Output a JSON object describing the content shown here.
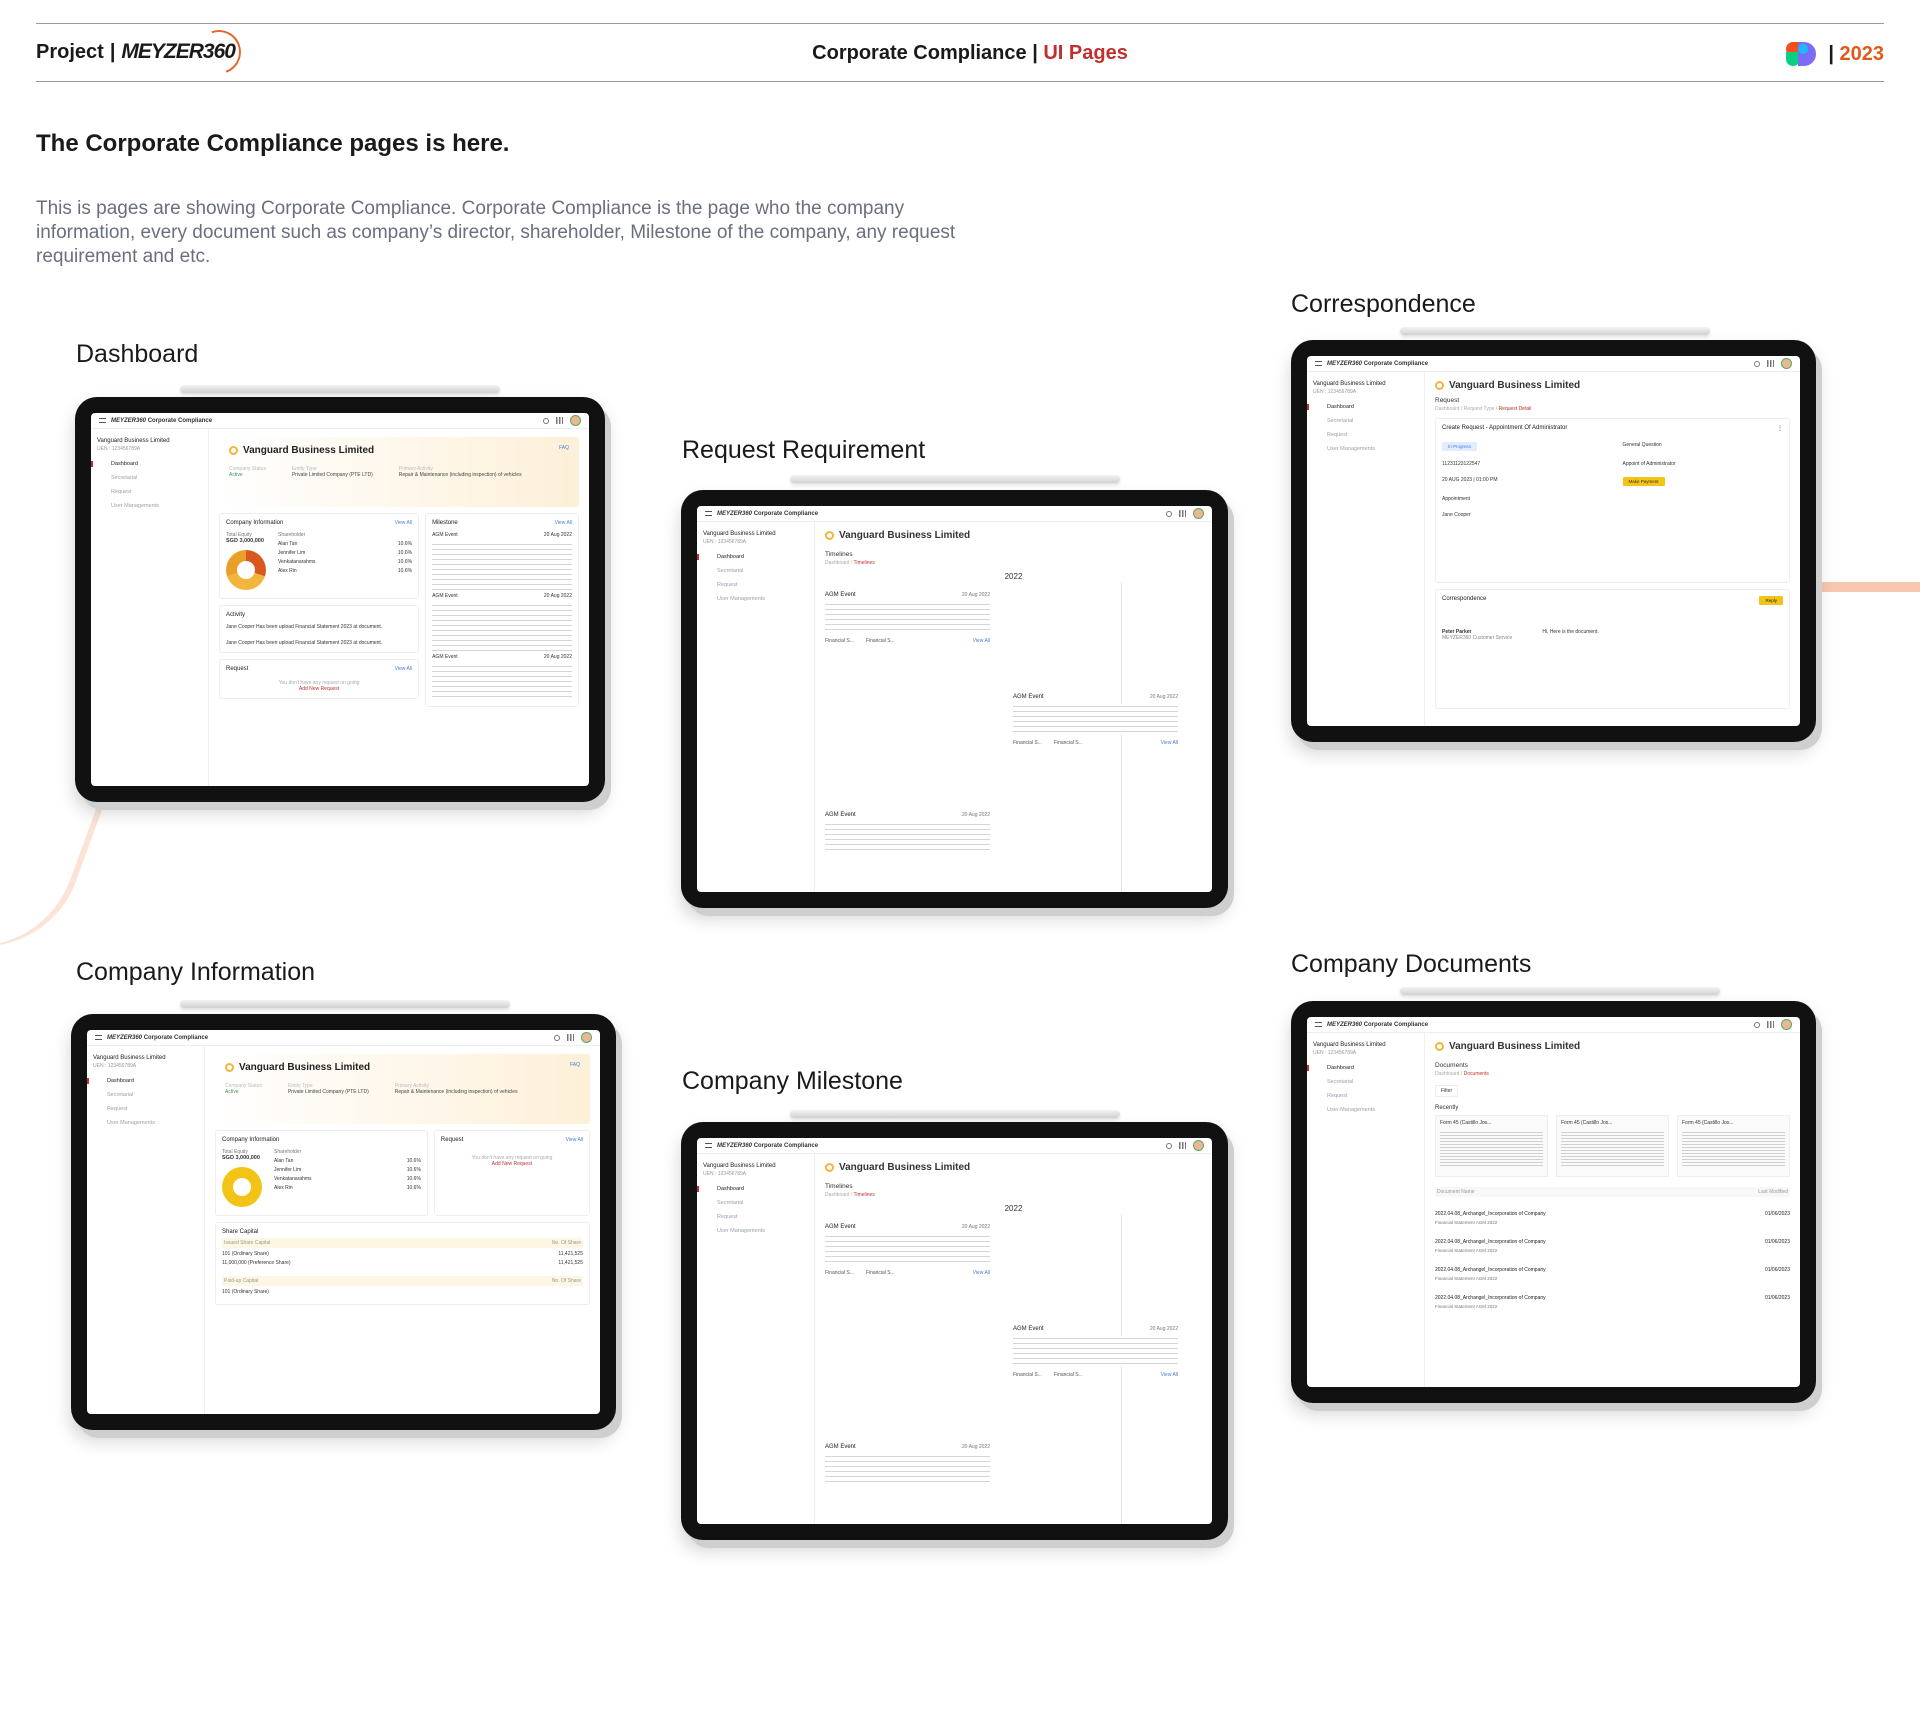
{
  "header": {
    "project_label": "Project",
    "logo_text": "MEYZER360",
    "title": "Corporate Compliance",
    "subtitle": "UI Pages",
    "year": "2023"
  },
  "intro": {
    "heading": "The Corporate Compliance pages is here.",
    "description": "This is pages are showing Corporate Compliance. Corporate Compliance is the page who the company information, every document such as company’s director, shareholder, Milestone of the company, any request requirement and etc."
  },
  "sections": {
    "dashboard": "Dashboard",
    "request": "Request Requirement",
    "correspondence": "Correspondence",
    "company_info": "Company Information",
    "milestone": "Company Milestone",
    "documents": "Company Documents"
  },
  "app": {
    "brand": "MEYZER360",
    "app_name": "Corporate Compliance",
    "company": "Vanguard Business Limited",
    "uen": "UEN : 123456789A",
    "nav": [
      "Dashboard",
      "Secretarial",
      "Request",
      "User Managements"
    ],
    "faq": "FAQ",
    "status_label": "Company Status",
    "status": "Active",
    "entity_label": "Entity Type",
    "entity": "Private Limited Company (PTE LTD)",
    "activity_label": "Primary Activity",
    "activity": "Repair & Maintenance (including inspection) of vehicles",
    "company_info": "Company Information",
    "view_all": "View All",
    "equity_label": "Total Equity",
    "equity": "SGD 3,000,000",
    "shareholder_label": "Shareholder",
    "shareholders": [
      {
        "name": "Alan Tan",
        "pct": "10.6%"
      },
      {
        "name": "Jennifer Lim",
        "pct": "10.6%"
      },
      {
        "name": "Venkatanarahms",
        "pct": "10.6%"
      },
      {
        "name": "Alex Rin",
        "pct": "10.6%"
      }
    ],
    "milestone": "Milestone",
    "agm": "AGM Event",
    "agm_date": "20 Aug 2022",
    "activity_title": "Activity",
    "activity_text": "Jane Cooper Has been upload Financial Statement 2023 at document.",
    "request_title": "Request",
    "request_empty": "You don't have any request on going",
    "add_request": "Add New Request",
    "timelines": "Timelines",
    "crumb_home": "Dashboard",
    "year": "2022",
    "financial": "Financial S...",
    "request_label": "Request",
    "request_crumb": "Dashboard / Request Type /",
    "request_detail": "Request Detail",
    "create_request": "Create Request - Appointment Of Administrator",
    "in_progress": "In Progress",
    "severity": "General Question",
    "case_id": "11231123122547",
    "category": "Appoint of Administrator",
    "created": "20 AUG 2023 | 01:00 PM",
    "make_payment": "Make Payment",
    "case_type": "Appointment",
    "create_by": "Jane Cooper",
    "correspondence": "Correspondence",
    "reply": "Reply",
    "sender": "Peter Parker",
    "sender_role": "MEYZER360 Customer Service",
    "msg": "Hi, Here is the document.",
    "share_capital": "Share Capital",
    "issued": "Issued Share Capital",
    "paidup": "Paid-up Capital",
    "no_share": "No. Of Share",
    "sc_rows": [
      {
        "a": "101",
        "b": "(Ordinary Share)",
        "c": "11,421,525"
      },
      {
        "a": "11,000,000",
        "b": "(Preference Share)",
        "c": "11,421,525"
      }
    ],
    "documents": "Documents",
    "filter": "Filter",
    "recently": "Recently",
    "form45": "Form 45 (Castillo Jos...",
    "doc_name": "Document Name",
    "last_mod": "Last Modified",
    "doc_file": "2022.04.08_Archangel_Incorporation of Company",
    "doc_tags": "Financial Statement    AGM    2022",
    "doc_date": "01/06/2023"
  }
}
